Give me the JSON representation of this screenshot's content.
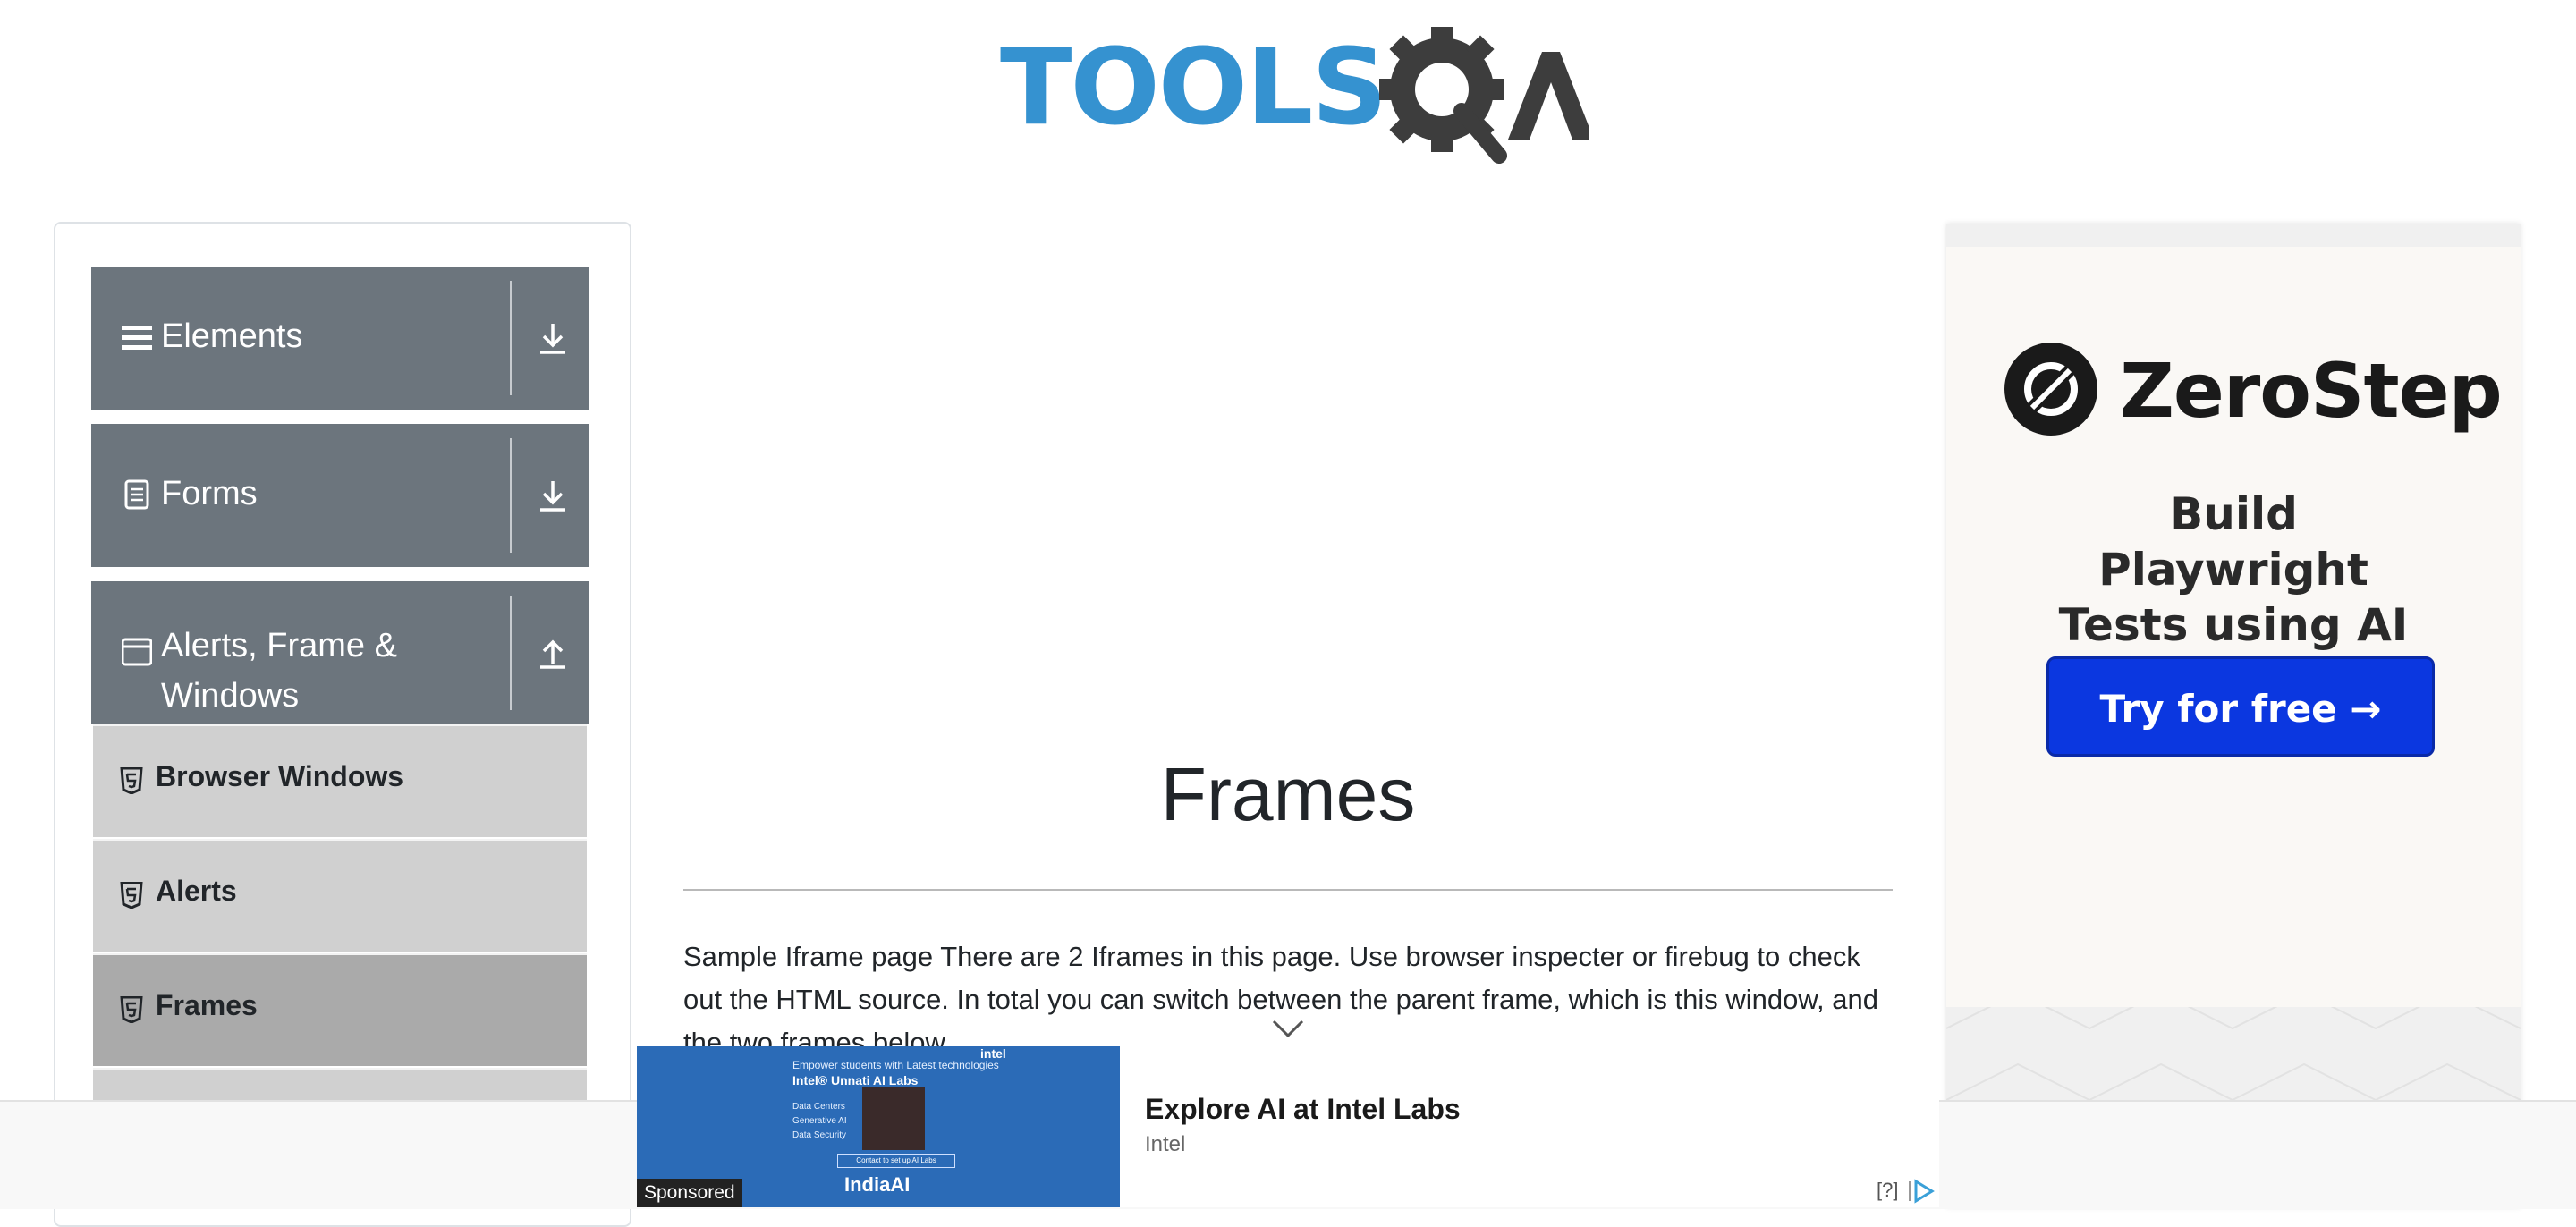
{
  "header": {
    "logo_text": "TOOLS",
    "logo_suffix": "A"
  },
  "sidebar": {
    "groups": [
      {
        "label": "Elements",
        "icon": "hamburger-icon",
        "arrow": "download-arrow-icon"
      },
      {
        "label": "Forms",
        "icon": "document-icon",
        "arrow": "download-arrow-icon"
      },
      {
        "label": "Alerts, Frame & Windows",
        "icon": "browser-window-icon",
        "arrow": "upload-arrow-icon",
        "expanded": true
      }
    ],
    "items": [
      {
        "label": "Browser Windows",
        "icon": "html5-icon",
        "active": false
      },
      {
        "label": "Alerts",
        "icon": "html5-icon",
        "active": false
      },
      {
        "label": "Frames",
        "icon": "html5-icon",
        "active": true
      }
    ]
  },
  "main": {
    "title": "Frames",
    "description": "Sample Iframe page There are 2 Iframes in this page. Use browser inspecter or firebug to check out the HTML source. In total you can switch between the parent frame, which is this window, and the two frames below"
  },
  "side_ad": {
    "brand": "ZeroStep",
    "tagline": "Build Playwright Tests using AI",
    "cta": "Try for free →",
    "accent": "#0b37e0"
  },
  "bottom_ad": {
    "title": "Explore AI at Intel Labs",
    "source": "Intel",
    "sponsored_label": "Sponsored",
    "help_label": "[?]",
    "thumbnail": {
      "headline": "Empower students with Latest technologies",
      "program": "Intel® Unnati AI Labs",
      "topics": [
        "Data Centers",
        "Generative AI",
        "Data Security"
      ],
      "button": "Contact to set up AI Labs",
      "brand": "IndiaAI",
      "corner_brand": "intel"
    }
  },
  "colors": {
    "sidebar_group_bg": "#6c757d",
    "sidebar_item_bg": "#d0d0d0",
    "sidebar_item_active_bg": "#aaaaaa",
    "logo_blue": "#3592d0",
    "logo_dark": "#3d3d3d"
  }
}
